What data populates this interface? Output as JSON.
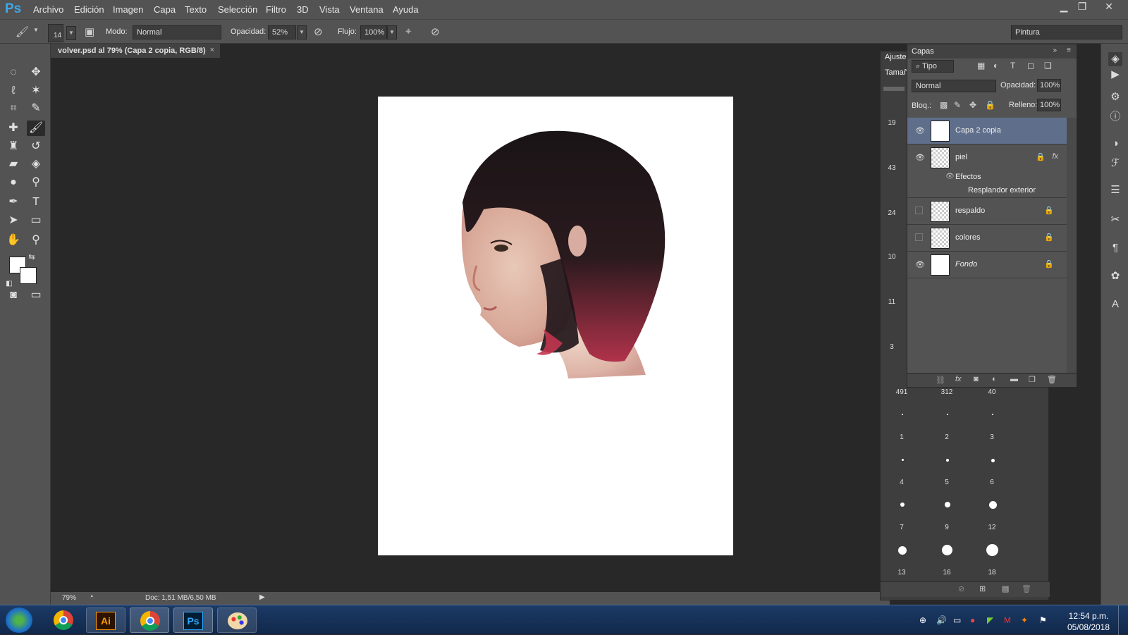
{
  "app": {
    "logo": "Ps"
  },
  "menu": [
    "Archivo",
    "Edición",
    "Imagen",
    "Capa",
    "Texto",
    "Selección",
    "Filtro",
    "3D",
    "Vista",
    "Ventana",
    "Ayuda"
  ],
  "options": {
    "brush_size": "14",
    "mode_label": "Modo:",
    "mode_value": "Normal",
    "opacity_label": "Opacidad:",
    "opacity_value": "52%",
    "flow_label": "Flujo:",
    "flow_value": "100%",
    "workspace": "Pintura"
  },
  "document": {
    "tab_title": "volver.psd al 79% (Capa 2 copia, RGB/8)",
    "zoom": "79%",
    "doc_info": "Doc: 1,51 MB/6,50 MB"
  },
  "adjust_panel": {
    "tab_label": "Ajuste",
    "size_label": "Tamañ"
  },
  "brushes": {
    "side_numbers": [
      "19",
      "43",
      "24",
      "10",
      "11",
      "3"
    ],
    "grid": [
      {
        "num": "491"
      },
      {
        "num": "312"
      },
      {
        "num": "40"
      },
      {
        "num": "1"
      },
      {
        "num": "2"
      },
      {
        "num": "3"
      },
      {
        "num": "4"
      },
      {
        "num": "5"
      },
      {
        "num": "6"
      },
      {
        "num": "7"
      },
      {
        "num": "9"
      },
      {
        "num": "12"
      },
      {
        "num": "13"
      },
      {
        "num": "16"
      },
      {
        "num": "18"
      }
    ]
  },
  "layers_panel": {
    "title": "Capas",
    "filter": "Tipo",
    "blend_mode": "Normal",
    "opacity_label": "Opacidad:",
    "opacity_value": "100%",
    "lock_label": "Bloq.:",
    "fill_label": "Relleno:",
    "fill_value": "100%",
    "effects_label": "Efectos",
    "effect_name": "Resplandor exterior",
    "fx_label": "fx",
    "layers": [
      {
        "name": "Capa 2 copia",
        "visible": true,
        "selected": true,
        "locked": false
      },
      {
        "name": "piel",
        "visible": true,
        "selected": false,
        "locked": true
      },
      {
        "name": "respaldo",
        "visible": false,
        "selected": false,
        "locked": true
      },
      {
        "name": "colores",
        "visible": false,
        "selected": false,
        "locked": true
      },
      {
        "name": "Fondo",
        "visible": true,
        "selected": false,
        "locked": true
      }
    ]
  },
  "taskbar": {
    "clock_time": "12:54 p.m.",
    "clock_date": "05/08/2018",
    "apps": [
      "chrome",
      "illustrator",
      "chrome-active",
      "photoshop",
      "paint"
    ],
    "illustrator_label": "Ai",
    "photoshop_label": "Ps"
  },
  "colors": {
    "ui_bg": "#535353",
    "workspace_bg": "#282828",
    "selected_layer": "#5f6e8a",
    "ps_blue": "#3da7e8",
    "taskbar": "#1b3a66"
  }
}
